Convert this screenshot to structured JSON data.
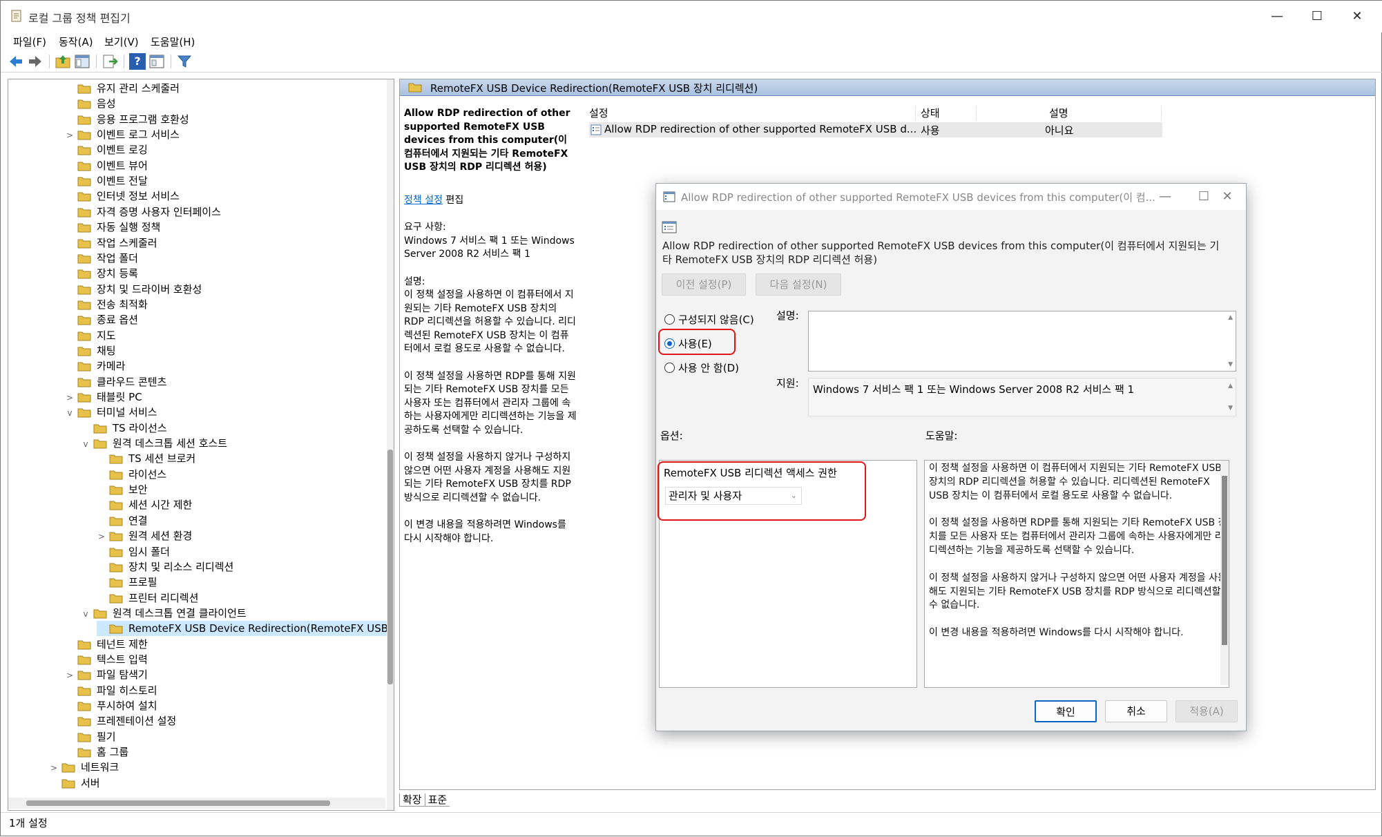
{
  "window": {
    "title": "로컬 그룹 정책 편집기",
    "controls": {
      "minimize": "—",
      "maximize": "☐",
      "close": "✕"
    }
  },
  "menu": [
    "파일(F)",
    "동작(A)",
    "보기(V)",
    "도움말(H)"
  ],
  "toolbar": {
    "icons": [
      "back-arrow-icon",
      "forward-arrow-icon",
      "folder-up-icon",
      "show-hide-tree-icon",
      "export-list-icon",
      "help-icon",
      "properties-icon",
      "filter-icon"
    ],
    "help_glyph": "?"
  },
  "tree": {
    "items": [
      {
        "label": "유지 관리 스케줄러",
        "level": 1,
        "twisty": ""
      },
      {
        "label": "음성",
        "level": 1,
        "twisty": ""
      },
      {
        "label": "응용 프로그램 호환성",
        "level": 1,
        "twisty": ""
      },
      {
        "label": "이벤트 로그 서비스",
        "level": 1,
        "twisty": ">"
      },
      {
        "label": "이벤트 로깅",
        "level": 1,
        "twisty": ""
      },
      {
        "label": "이벤트 뷰어",
        "level": 1,
        "twisty": ""
      },
      {
        "label": "이벤트 전달",
        "level": 1,
        "twisty": ""
      },
      {
        "label": "인터넷 정보 서비스",
        "level": 1,
        "twisty": ""
      },
      {
        "label": "자격 증명 사용자 인터페이스",
        "level": 1,
        "twisty": ""
      },
      {
        "label": "자동 실행 정책",
        "level": 1,
        "twisty": ""
      },
      {
        "label": "작업 스케줄러",
        "level": 1,
        "twisty": ""
      },
      {
        "label": "작업 폴더",
        "level": 1,
        "twisty": ""
      },
      {
        "label": "장치 등록",
        "level": 1,
        "twisty": ""
      },
      {
        "label": "장치 및 드라이버 호환성",
        "level": 1,
        "twisty": ""
      },
      {
        "label": "전송 최적화",
        "level": 1,
        "twisty": ""
      },
      {
        "label": "종료 옵션",
        "level": 1,
        "twisty": ""
      },
      {
        "label": "지도",
        "level": 1,
        "twisty": ""
      },
      {
        "label": "채팅",
        "level": 1,
        "twisty": ""
      },
      {
        "label": "카메라",
        "level": 1,
        "twisty": ""
      },
      {
        "label": "클라우드 콘텐츠",
        "level": 1,
        "twisty": ""
      },
      {
        "label": "태블릿 PC",
        "level": 1,
        "twisty": ">"
      },
      {
        "label": "터미널 서비스",
        "level": 1,
        "twisty": "v"
      },
      {
        "label": "TS 라이선스",
        "level": 2,
        "twisty": ""
      },
      {
        "label": "원격 데스크톱 세션 호스트",
        "level": 2,
        "twisty": "v"
      },
      {
        "label": "TS 세션 브로커",
        "level": 3,
        "twisty": ""
      },
      {
        "label": "라이선스",
        "level": 3,
        "twisty": ""
      },
      {
        "label": "보안",
        "level": 3,
        "twisty": ""
      },
      {
        "label": "세션 시간 제한",
        "level": 3,
        "twisty": ""
      },
      {
        "label": "연결",
        "level": 3,
        "twisty": ""
      },
      {
        "label": "원격 세션 환경",
        "level": 3,
        "twisty": ">"
      },
      {
        "label": "임시 폴더",
        "level": 3,
        "twisty": ""
      },
      {
        "label": "장치 및 리소스 리디렉션",
        "level": 3,
        "twisty": ""
      },
      {
        "label": "프로필",
        "level": 3,
        "twisty": ""
      },
      {
        "label": "프린터 리디렉션",
        "level": 3,
        "twisty": ""
      },
      {
        "label": "원격 데스크톱 연결 클라이언트",
        "level": 2,
        "twisty": "v"
      },
      {
        "label": "RemoteFX USB Device Redirection(RemoteFX USB 장치",
        "level": 3,
        "twisty": "",
        "selected": true
      },
      {
        "label": "테넌트 제한",
        "level": 1,
        "twisty": ""
      },
      {
        "label": "텍스트 입력",
        "level": 1,
        "twisty": ""
      },
      {
        "label": "파일 탐색기",
        "level": 1,
        "twisty": ">"
      },
      {
        "label": "파일 히스토리",
        "level": 1,
        "twisty": ""
      },
      {
        "label": "푸시하여 설치",
        "level": 1,
        "twisty": ""
      },
      {
        "label": "프레젠테이션 설정",
        "level": 1,
        "twisty": ""
      },
      {
        "label": "필기",
        "level": 1,
        "twisty": ""
      },
      {
        "label": "홈 그룹",
        "level": 1,
        "twisty": ""
      },
      {
        "label": "네트워크",
        "level": 0,
        "twisty": ">"
      },
      {
        "label": "서버",
        "level": 0,
        "twisty": ""
      }
    ]
  },
  "right": {
    "path": "RemoteFX USB Device Redirection(RemoteFX USB 장치 리디렉션)",
    "desc": {
      "title": "Allow RDP redirection of other supported RemoteFX USB devices from this computer(이 컴퓨터에서 지원되는 기타 RemoteFX USB 장치의 RDP 리디렉션 허용)",
      "edit_link": "정책 설정",
      "edit_suffix": " 편집",
      "req_label": "요구 사항:",
      "req_text": "Windows 7 서비스 팩 1 또는 Windows Server 2008 R2 서비스 팩 1",
      "desc_label": "설명:",
      "desc_p1": "이 정책 설정을 사용하면 이 컴퓨터에서 지원되는 기타 RemoteFX USB 장치의 RDP 리디렉션을 허용할 수 있습니다. 리디렉션된 RemoteFX USB 장치는 이 컴퓨터에서 로컬 용도로 사용할 수 없습니다.",
      "desc_p2": "이 정책 설정을 사용하면 RDP를 통해 지원되는 기타 RemoteFX USB 장치를 모든 사용자 또는 컴퓨터에서 관리자 그룹에 속하는 사용자에게만 리디렉션하는 기능을 제공하도록 선택할 수 있습니다.",
      "desc_p3": "이 정책 설정을 사용하지 않거나 구성하지 않으면 어떤 사용자 계정을 사용해도 지원되는 기타 RemoteFX USB 장치를 RDP 방식으로 리디렉션할 수 없습니다.",
      "desc_p4": "이 변경 내용을 적용하려면 Windows를 다시 시작해야 합니다."
    },
    "columns": {
      "setting": "설정",
      "state": "상태",
      "comment": "설명"
    },
    "row": {
      "setting": "Allow RDP redirection of other supported RemoteFX USB d...",
      "state": "사용",
      "comment": "아니요"
    }
  },
  "tabs": {
    "expanded": "확장",
    "standard": "표준"
  },
  "status": "1개 설정",
  "dialog": {
    "title": "Allow RDP redirection of other supported RemoteFX USB devices from this computer(이 컴...",
    "policy_name": "Allow RDP redirection of other supported RemoteFX USB devices from this computer(이 컴퓨터에서 지원되는 기타 RemoteFX USB 장치의 RDP 리디렉션 허용)",
    "prev": "이전 설정(P)",
    "next": "다음 설정(N)",
    "radio_not_configured": "구성되지 않음(C)",
    "radio_enabled": "사용(E)",
    "radio_disabled": "사용 안 함(D)",
    "comment_label": "설명:",
    "comment_value": "",
    "supported_label": "지원:",
    "supported_value": "Windows 7 서비스 팩 1 또는 Windows Server 2008 R2 서비스 팩 1",
    "options_label": "옵션:",
    "help_label": "도움말:",
    "option_title": "RemoteFX USB 리디렉션 액세스 권한",
    "option_value": "관리자 및 사용자",
    "help_p1": "이 정책 설정을 사용하면 이 컴퓨터에서 지원되는 기타 RemoteFX USB 장치의 RDP 리디렉션을 허용할 수 있습니다. 리디렉션된 RemoteFX USB 장치는 이 컴퓨터에서 로컬 용도로 사용할 수 없습니다.",
    "help_p2": "이 정책 설정을 사용하면 RDP를 통해 지원되는 기타 RemoteFX USB 장치를 모든 사용자 또는 컴퓨터에서 관리자 그룹에 속하는 사용자에게만 리디렉션하는 기능을 제공하도록 선택할 수 있습니다.",
    "help_p3": "이 정책 설정을 사용하지 않거나 구성하지 않으면 어떤 사용자 계정을 사용해도 지원되는 기타 RemoteFX USB 장치를 RDP 방식으로 리디렉션할 수 없습니다.",
    "help_p4": "이 변경 내용을 적용하려면 Windows를 다시 시작해야 합니다.",
    "ok": "확인",
    "cancel": "취소",
    "apply": "적용(A)"
  },
  "colors": {
    "highlight": "#e01515",
    "selection": "#cce8ff",
    "link": "#0066cc",
    "folder": "#e8c14a"
  }
}
